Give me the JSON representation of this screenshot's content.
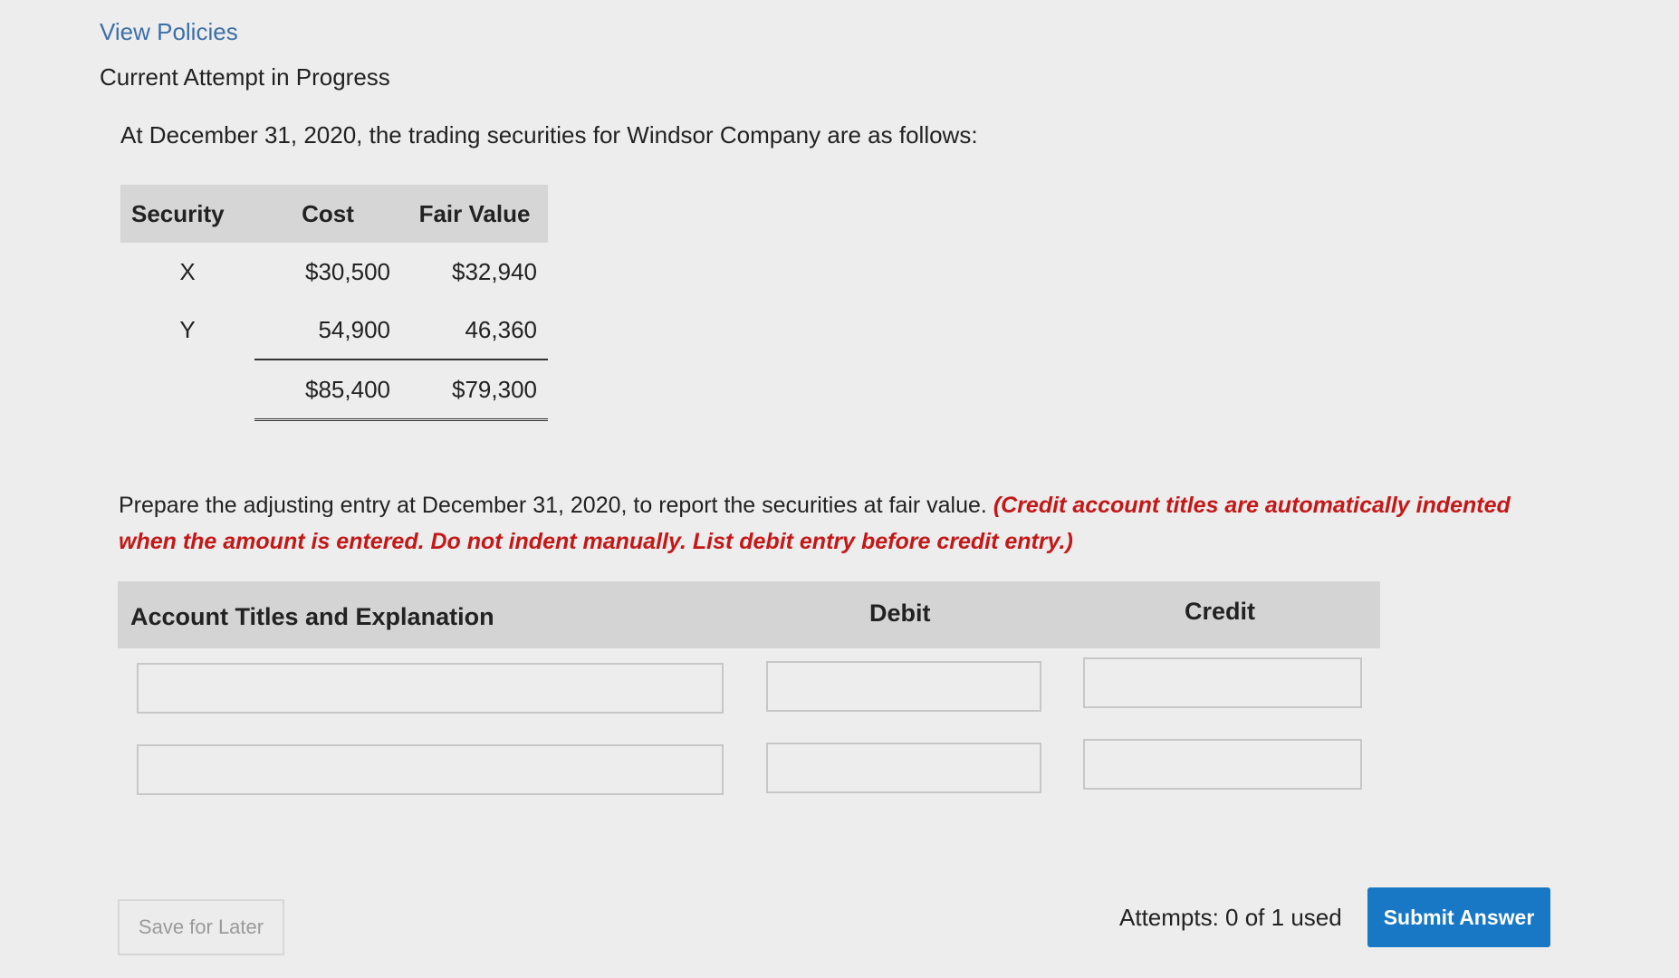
{
  "links": {
    "view_policies": "View Policies"
  },
  "attempt": {
    "title": "Current Attempt in Progress"
  },
  "question": {
    "intro": "At December 31, 2020, the trading securities for Windsor Company are as follows:",
    "table": {
      "headers": [
        "Security",
        "Cost",
        "Fair Value"
      ],
      "rows": [
        {
          "security": "X",
          "cost": "$30,500",
          "fair_value": "$32,940"
        },
        {
          "security": "Y",
          "cost": "54,900",
          "fair_value": "46,360"
        }
      ],
      "totals": {
        "cost": "$85,400",
        "fair_value": "$79,300"
      }
    },
    "instructions": "Prepare the adjusting entry at December 31, 2020, to report the securities at fair value.",
    "note": "(Credit account titles are automatically indented when the amount is entered. Do not indent manually. List debit entry before credit entry.)"
  },
  "journal": {
    "headers": {
      "account": "Account Titles and Explanation",
      "debit": "Debit",
      "credit": "Credit"
    },
    "rows": [
      {
        "account": "",
        "debit": "",
        "credit": ""
      },
      {
        "account": "",
        "debit": "",
        "credit": ""
      }
    ]
  },
  "footer": {
    "save_label": "Save for Later",
    "attempts_text": "Attempts: 0 of 1 used",
    "submit_label": "Submit Answer"
  }
}
